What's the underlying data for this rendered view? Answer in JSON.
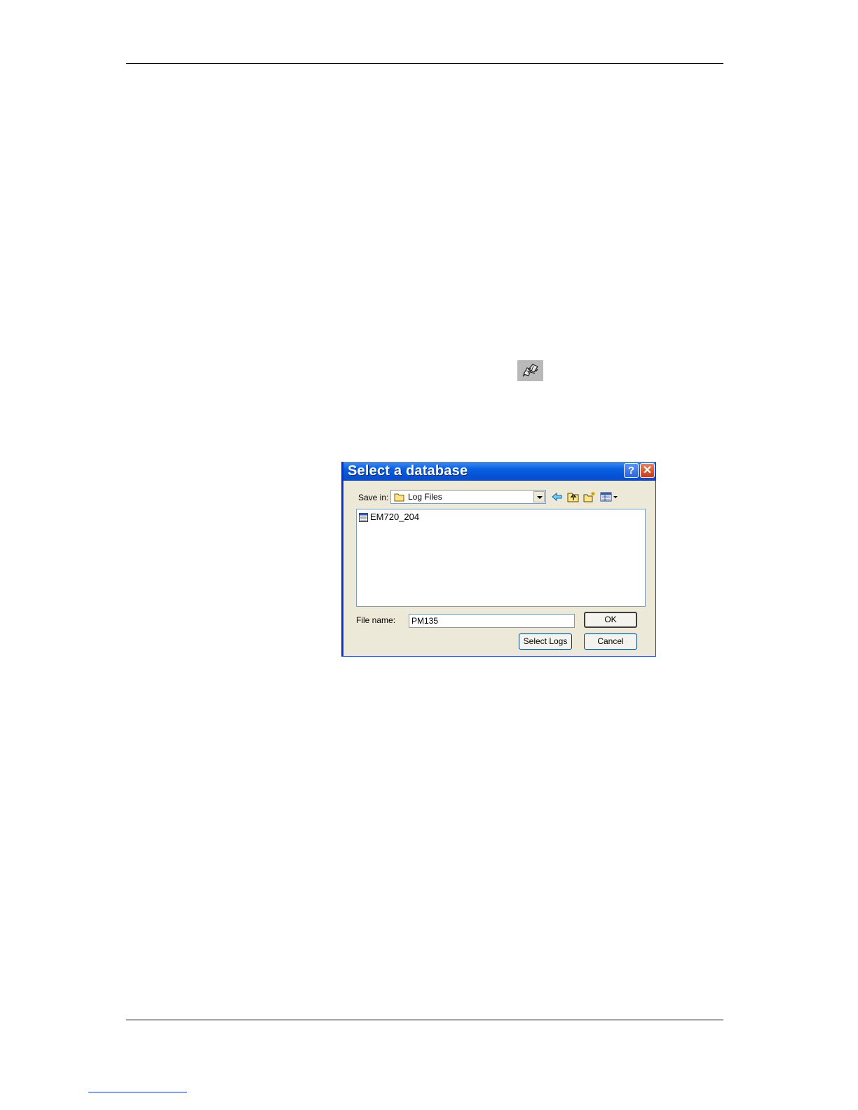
{
  "page": {
    "icon_name": "connect-toolbar-icon"
  },
  "dialog": {
    "title": "Select a database",
    "help_button": "?",
    "close_button": "✕",
    "save_in_label": "Save in:",
    "save_in_value": "Log Files",
    "toolbar_icons": [
      "back-arrow-icon",
      "up-folder-icon",
      "new-folder-icon",
      "view-menu-icon"
    ],
    "files": [
      {
        "name": "EM720_204",
        "icon": "database-file-icon"
      }
    ],
    "file_name_label": "File name:",
    "file_name_value": "PM135",
    "ok_label": "OK",
    "select_logs_label": "Select Logs",
    "cancel_label": "Cancel"
  }
}
